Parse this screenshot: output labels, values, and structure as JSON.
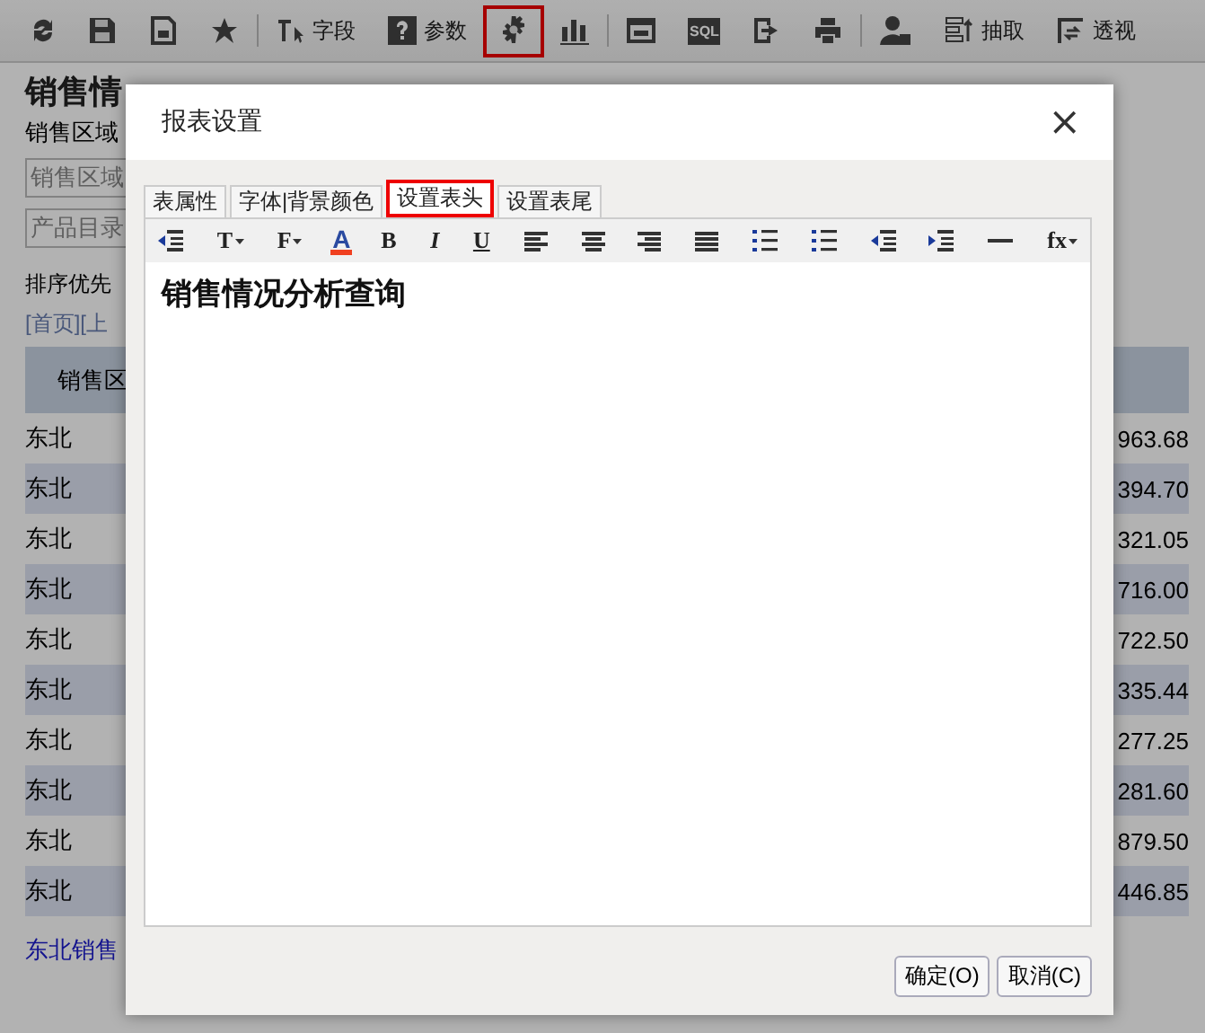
{
  "toolbar": [
    {
      "kind": "icon",
      "selected": false
    },
    {
      "kind": "icon",
      "selected": false
    },
    {
      "kind": "icon",
      "selected": false
    },
    {
      "kind": "icon",
      "selected": false
    },
    {
      "kind": "sep"
    },
    {
      "kind": "labeled",
      "label": "字段",
      "selected": false
    },
    {
      "kind": "labeled",
      "label": "参数",
      "selected": false
    },
    {
      "kind": "icon",
      "selected": true
    },
    {
      "kind": "icon",
      "selected": false
    },
    {
      "kind": "sep"
    },
    {
      "kind": "icon",
      "selected": false
    },
    {
      "kind": "sql",
      "label": "SQL",
      "selected": false
    },
    {
      "kind": "icon",
      "selected": false
    },
    {
      "kind": "icon",
      "selected": false
    },
    {
      "kind": "sep"
    },
    {
      "kind": "icon",
      "selected": false
    },
    {
      "kind": "labeled",
      "label": "抽取",
      "selected": false
    },
    {
      "kind": "labeled",
      "label": "透视",
      "selected": false
    }
  ],
  "page": {
    "title": "销售情",
    "filter_label": "销售区域",
    "fields": [
      {
        "value": "销售区域"
      },
      {
        "value": "产品目录"
      }
    ],
    "sort_label": "排序优先",
    "pager": "[首页][上",
    "table": {
      "columns": [
        "销售区"
      ],
      "rows": [
        {
          "region": "东北",
          "amount": "963.68"
        },
        {
          "region": "东北",
          "amount": "394.70"
        },
        {
          "region": "东北",
          "amount": "321.05"
        },
        {
          "region": "东北",
          "amount": "716.00"
        },
        {
          "region": "东北",
          "amount": "722.50"
        },
        {
          "region": "东北",
          "amount": "335.44"
        },
        {
          "region": "东北",
          "amount": "277.25"
        },
        {
          "region": "东北",
          "amount": "281.60"
        },
        {
          "region": "东北",
          "amount": "879.50"
        },
        {
          "region": "东北",
          "amount": "446.85"
        }
      ]
    },
    "link": "东北销售"
  },
  "dialog": {
    "title": "报表设置",
    "close": "×",
    "tabs": [
      {
        "label": "表属性",
        "selected": false
      },
      {
        "label": "字体|背景颜色",
        "selected": false
      },
      {
        "label": "设置表头",
        "selected": true
      },
      {
        "label": "设置表尾",
        "selected": false
      }
    ],
    "editor_tools": [
      {
        "kind": "icon"
      },
      {
        "kind": "dropdown",
        "label": "T"
      },
      {
        "kind": "dropdown",
        "label": "F"
      },
      {
        "kind": "color",
        "label": "A"
      },
      {
        "kind": "text",
        "label": "B"
      },
      {
        "kind": "italic",
        "label": "I"
      },
      {
        "kind": "underline",
        "label": "U"
      },
      {
        "kind": "icon"
      },
      {
        "kind": "icon"
      },
      {
        "kind": "icon"
      },
      {
        "kind": "icon"
      },
      {
        "kind": "icon"
      },
      {
        "kind": "icon"
      },
      {
        "kind": "icon"
      },
      {
        "kind": "icon"
      },
      {
        "kind": "icon"
      },
      {
        "kind": "dropdown",
        "label": "fx"
      }
    ],
    "content": "销售情况分析查询",
    "buttons": [
      "确定(O)",
      "取消(C)"
    ]
  }
}
